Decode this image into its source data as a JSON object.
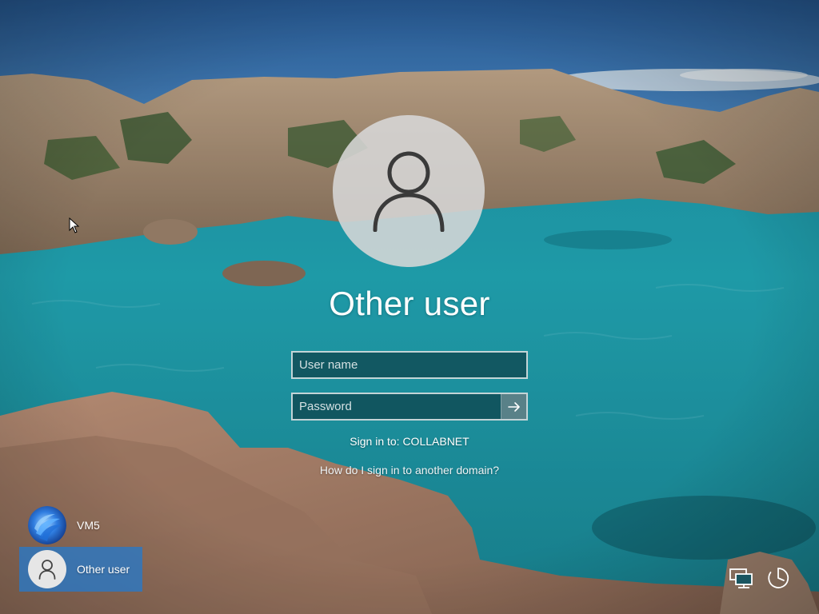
{
  "login": {
    "selected_user": "Other user",
    "username_placeholder": "User name",
    "password_placeholder": "Password",
    "sign_in_to": "Sign in to: COLLABNET",
    "domain_help_link": "How do I sign in to another domain?"
  },
  "accounts": [
    {
      "name": "VM5",
      "icon": "windows-bloom-avatar-icon",
      "selected": false
    },
    {
      "name": "Other user",
      "icon": "user-icon",
      "selected": true
    }
  ],
  "system_icons": [
    "network-icon",
    "accessibility-icon"
  ],
  "colors": {
    "selected_account_bg": "#2878c8",
    "field_border": "#ffffff",
    "avatar_bg": "#d7d7d7"
  }
}
